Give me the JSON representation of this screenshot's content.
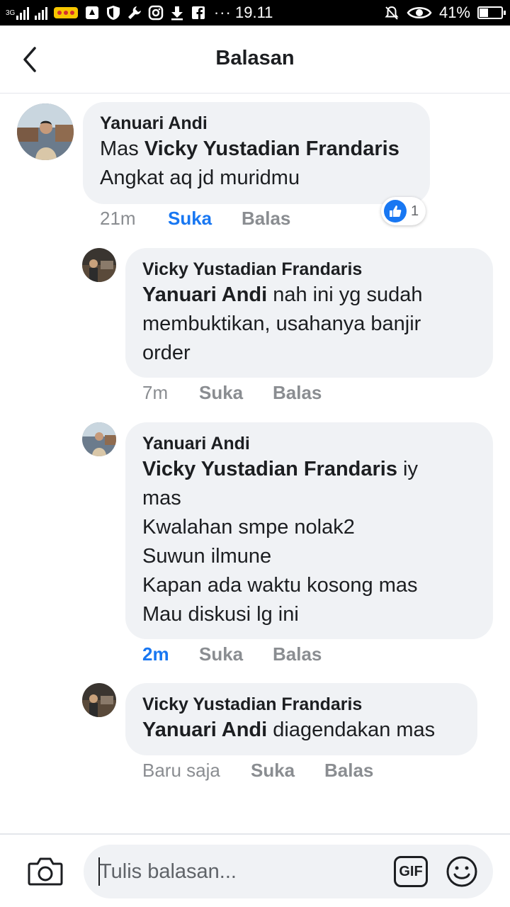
{
  "status_bar": {
    "network": "3G",
    "time": "19.11",
    "battery": "41%",
    "battery_level": 0.41,
    "icons": [
      "signal-icon",
      "sim-signal-icon",
      "sticker-icon",
      "map-icon",
      "shield-icon",
      "wrench-icon",
      "instagram-icon",
      "download-icon",
      "facebook-icon",
      "more-icon",
      "mute-icon",
      "eye-icon",
      "battery-icon"
    ]
  },
  "header": {
    "title": "Balasan",
    "back_icon": "chevron-left-icon"
  },
  "comments": [
    {
      "author": "Yanuari Andi",
      "lines": [
        {
          "mention": "",
          "text": "Mas "
        },
        {
          "mention": "Vicky Yustadian Frandaris",
          "text": ""
        },
        {
          "mention": "",
          "text": "Angkat aq jd muridmu"
        }
      ],
      "time": "21m",
      "like_label": "Suka",
      "reply_label": "Balas",
      "liked": true,
      "reaction_count": "1",
      "reaction_icon": "like-reaction-icon"
    },
    {
      "author": "Vicky Yustadian Frandaris",
      "lines": [
        {
          "mention": "Yanuari Andi",
          "text": " nah ini yg sudah"
        },
        {
          "mention": "",
          "text": "membuktikan, usahanya banjir"
        },
        {
          "mention": "",
          "text": "order"
        }
      ],
      "time": "7m",
      "like_label": "Suka",
      "reply_label": "Balas"
    },
    {
      "author": "Yanuari Andi",
      "lines": [
        {
          "mention": "Vicky Yustadian Frandaris",
          "text": " iy"
        },
        {
          "mention": "",
          "text": "mas"
        },
        {
          "mention": "",
          "text": "Kwalahan smpe nolak2"
        },
        {
          "mention": "",
          "text": "Suwun ilmune"
        },
        {
          "mention": "",
          "text": "Kapan ada waktu kosong mas"
        },
        {
          "mention": "",
          "text": "Mau diskusi lg ini"
        }
      ],
      "time": "2m",
      "like_label": "Suka",
      "reply_label": "Balas"
    },
    {
      "author": "Vicky Yustadian Frandaris",
      "lines": [
        {
          "mention": "Yanuari Andi",
          "text": " diagendakan mas"
        }
      ],
      "time": "Baru saja",
      "like_label": "Suka",
      "reply_label": "Balas"
    }
  ],
  "composer": {
    "placeholder": "Tulis balasan...",
    "gif_label": "GIF",
    "camera_icon": "camera-icon",
    "emoji_icon": "emoji-icon"
  },
  "colors": {
    "accent": "#1877f2",
    "bubble": "#f0f2f5",
    "text": "#1c1e21",
    "muted": "#8a8d91"
  }
}
